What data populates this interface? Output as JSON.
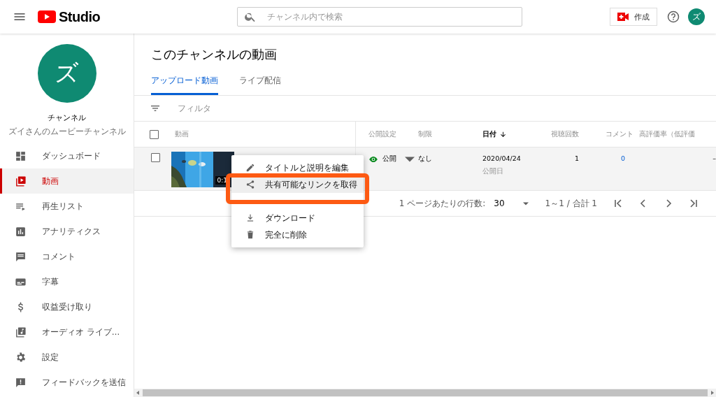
{
  "header": {
    "logo_text": "Studio",
    "search_placeholder": "チャンネル内で検索",
    "create_label": "作成",
    "avatar_letter": "ズ"
  },
  "channel": {
    "avatar_letter": "ズ",
    "name": "チャンネル",
    "subtitle": "ズイさんのムービーチャンネル"
  },
  "nav": [
    {
      "kind": "dashboard",
      "label": "ダッシュボード",
      "selected": false
    },
    {
      "kind": "videos",
      "label": "動画",
      "selected": true
    },
    {
      "kind": "playlists",
      "label": "再生リスト",
      "selected": false
    },
    {
      "kind": "analytics",
      "label": "アナリティクス",
      "selected": false
    },
    {
      "kind": "comments",
      "label": "コメント",
      "selected": false
    },
    {
      "kind": "subtitles",
      "label": "字幕",
      "selected": false
    },
    {
      "kind": "monetization",
      "label": "収益受け取り",
      "selected": false
    },
    {
      "kind": "audio",
      "label": "オーディオ ライブ…",
      "selected": false
    },
    {
      "kind": "settings",
      "label": "設定",
      "selected": false
    },
    {
      "kind": "feedback",
      "label": "フィードバックを送信",
      "selected": false
    }
  ],
  "page_title": "このチャンネルの動画",
  "tabs": [
    {
      "label": "アップロード動画",
      "selected": true
    },
    {
      "label": "ライブ配信",
      "selected": false
    }
  ],
  "filter_label": "フィルタ",
  "table": {
    "select_all_checked": false,
    "columns": [
      {
        "label": "動画",
        "sorted": false
      },
      {
        "label": "公開設定",
        "sorted": false
      },
      {
        "label": "制限",
        "sorted": false
      },
      {
        "label": "日付",
        "sorted": true
      },
      {
        "label": "視聴回数",
        "sorted": false
      },
      {
        "label": "コメント",
        "sorted": false
      },
      {
        "label": "高評価率（低評価",
        "sorted": false
      }
    ],
    "rows": [
      {
        "checked": false,
        "duration": "0:1",
        "visibility": "公開",
        "restriction": "なし",
        "date": "2020/04/24",
        "date_note": "公開日",
        "views": "1",
        "comments": "0",
        "rating": "–"
      }
    ]
  },
  "pagination": {
    "rows_label": "1 ページあたりの行数:",
    "rows_value": "30",
    "range": "1～1 / 合計 1"
  },
  "context_menu": {
    "items": [
      {
        "kind": "edit",
        "label": "タイトルと説明を編集",
        "highlighted": false
      },
      {
        "kind": "share",
        "label": "共有可能なリンクを取得",
        "highlighted": true
      },
      {
        "kind": "download",
        "label": "ダウンロード",
        "highlighted": false
      },
      {
        "kind": "delete",
        "label": "完全に削除",
        "highlighted": false
      }
    ]
  }
}
